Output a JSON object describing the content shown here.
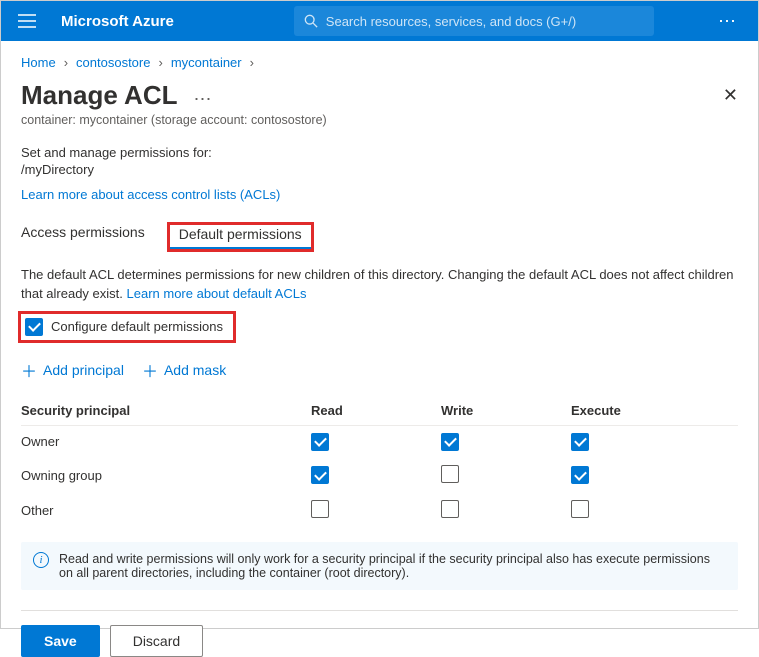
{
  "topbar": {
    "brand": "Microsoft Azure",
    "search_placeholder": "Search resources, services, and docs (G+/)"
  },
  "breadcrumb": {
    "home": "Home",
    "storage": "contosostore",
    "container": "mycontainer"
  },
  "page": {
    "title": "Manage ACL",
    "subtitle": "container: mycontainer (storage account: contosostore)",
    "close": "✕"
  },
  "context": {
    "label": "Set and manage permissions for:",
    "path": "/myDirectory",
    "learn_link": "Learn more about access control lists (ACLs)"
  },
  "tabs": {
    "access": "Access permissions",
    "default": "Default permissions"
  },
  "default_desc": {
    "text": "The default ACL determines permissions for new children of this directory. Changing the default ACL does not affect children that already exist. ",
    "link": "Learn more about default ACLs"
  },
  "config_checkbox": {
    "label": "Configure default permissions",
    "checked": true
  },
  "actions": {
    "add_principal": "Add principal",
    "add_mask": "Add mask"
  },
  "table": {
    "columns": {
      "principal": "Security principal",
      "read": "Read",
      "write": "Write",
      "execute": "Execute"
    },
    "rows": [
      {
        "name": "Owner",
        "read": true,
        "write": true,
        "execute": true
      },
      {
        "name": "Owning group",
        "read": true,
        "write": false,
        "execute": true
      },
      {
        "name": "Other",
        "read": false,
        "write": false,
        "execute": false
      }
    ]
  },
  "info": "Read and write permissions will only work for a security principal if the security principal also has execute permissions on all parent directories, including the container (root directory).",
  "buttons": {
    "save": "Save",
    "discard": "Discard"
  }
}
